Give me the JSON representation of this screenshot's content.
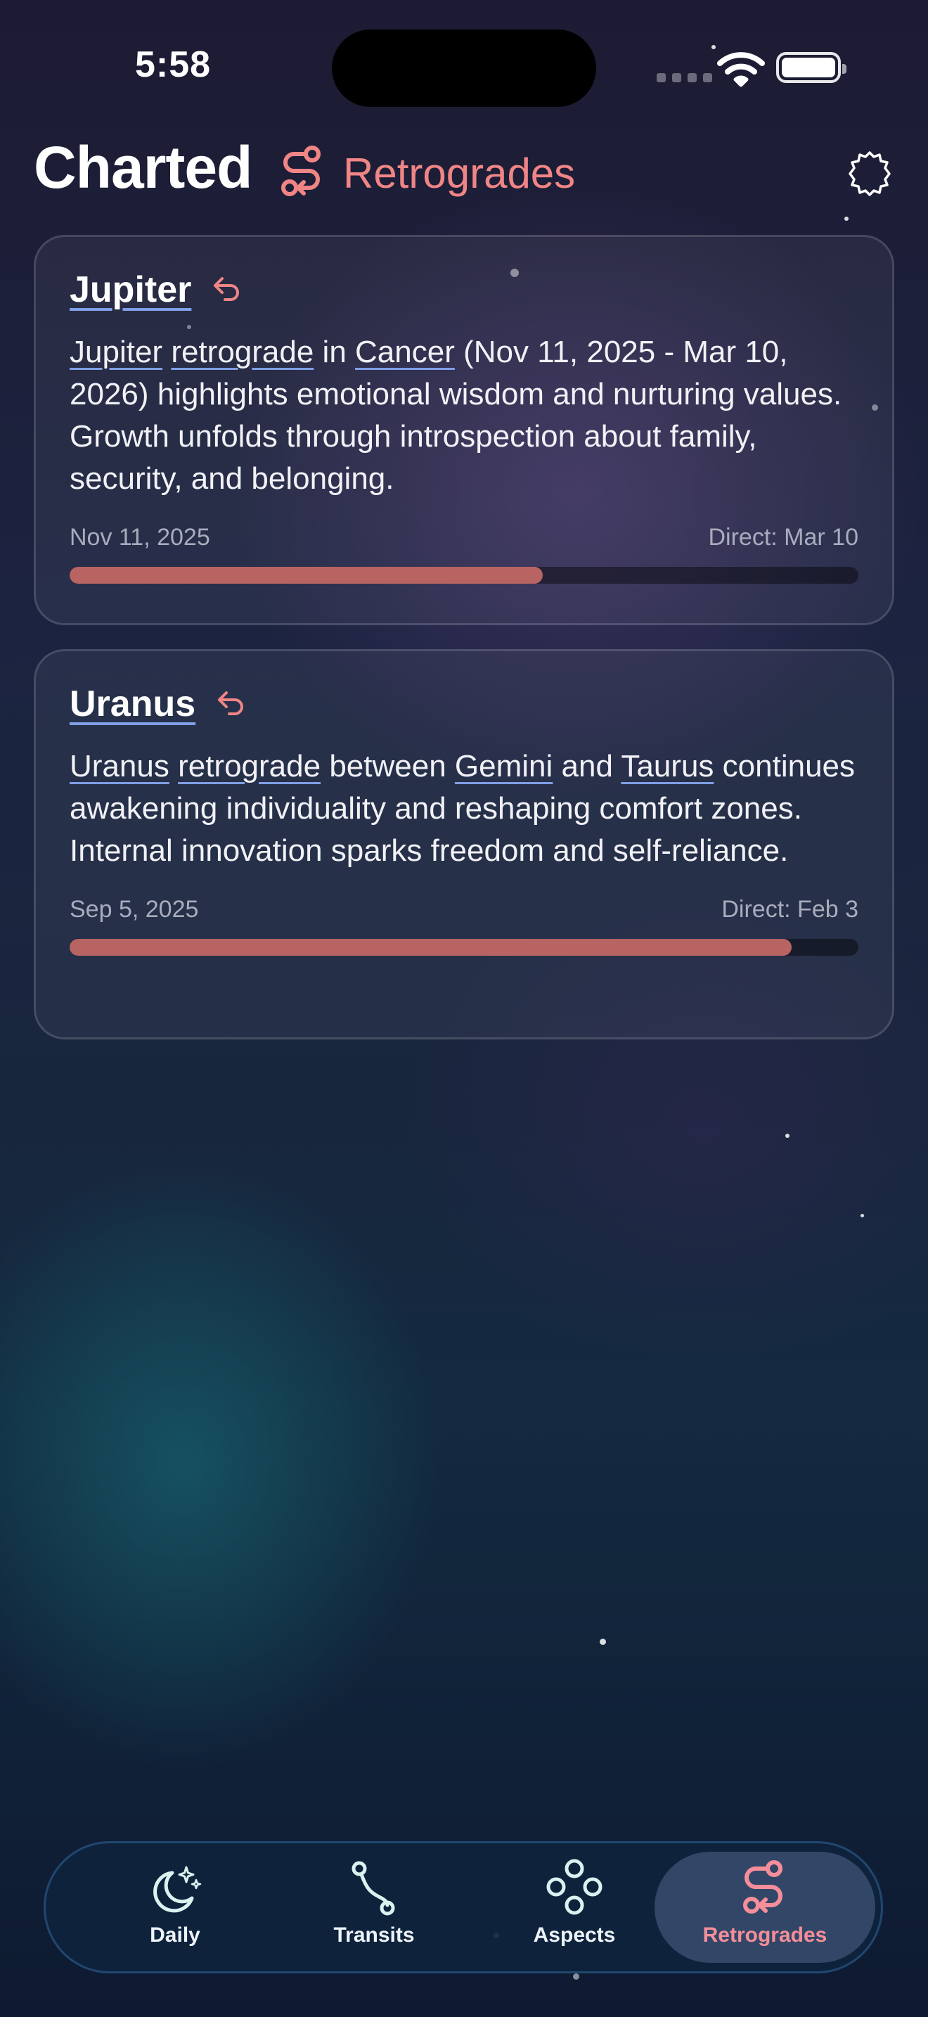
{
  "status_bar": {
    "time": "5:58"
  },
  "header": {
    "app_title": "Charted",
    "section_title": "Retrogrades",
    "section_icon": "retrograde-path-icon",
    "settings_icon": "gear-icon"
  },
  "retrogrades": [
    {
      "planet": "Jupiter",
      "description_parts": [
        {
          "text": "Jupiter",
          "link": true
        },
        {
          "text": " ",
          "link": false
        },
        {
          "text": "retrograde",
          "link": true
        },
        {
          "text": " in ",
          "link": false
        },
        {
          "text": "Cancer",
          "link": true
        },
        {
          "text": " (Nov 11, 2025 - Mar 10, 2026) highlights emotional wisdom and nurturing values. Growth unfolds through introspection about family, security, and belonging.",
          "link": false
        }
      ],
      "start_date": "Nov 11, 2025",
      "direct_label": "Direct: Mar 10",
      "progress": 0.6
    },
    {
      "planet": "Uranus",
      "description_parts": [
        {
          "text": "Uranus",
          "link": true
        },
        {
          "text": " ",
          "link": false
        },
        {
          "text": "retrograde",
          "link": true
        },
        {
          "text": " between ",
          "link": false
        },
        {
          "text": "Gemini",
          "link": true
        },
        {
          "text": " and ",
          "link": false
        },
        {
          "text": "Taurus",
          "link": true
        },
        {
          "text": " continues awakening individuality and reshaping comfort zones. Internal innovation sparks freedom and self-reliance.",
          "link": false
        }
      ],
      "start_date": "Sep 5, 2025",
      "direct_label": "Direct: Feb 3",
      "progress": 0.915
    }
  ],
  "tabs": [
    {
      "label": "Daily",
      "icon": "moon-stars-icon",
      "active": false
    },
    {
      "label": "Transits",
      "icon": "transit-path-icon",
      "active": false
    },
    {
      "label": "Aspects",
      "icon": "aspects-circles-icon",
      "active": false
    },
    {
      "label": "Retrogrades",
      "icon": "retrograde-path-icon",
      "active": true
    }
  ],
  "colors": {
    "accent": "#f08585",
    "progress_fill": "#b86462",
    "link_underline": "#7f9fe6",
    "active_tab_label": "#f58e9a"
  }
}
